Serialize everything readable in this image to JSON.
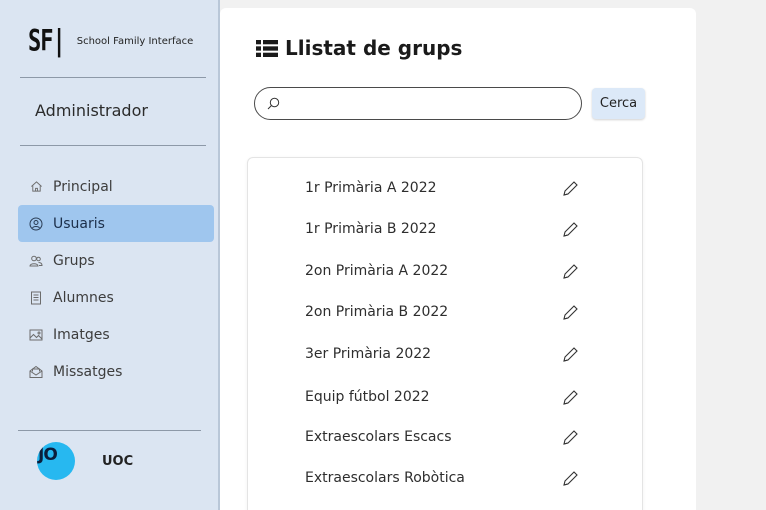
{
  "sidebar": {
    "logo_mark": "SF|",
    "brand": "School Family Interface",
    "role": "Administrador",
    "items": [
      {
        "label": "Principal",
        "icon": "home-icon"
      },
      {
        "label": "Usuaris",
        "icon": "user-circle-icon"
      },
      {
        "label": "Grups",
        "icon": "users-icon"
      },
      {
        "label": "Alumnes",
        "icon": "document-icon"
      },
      {
        "label": "Imatges",
        "icon": "image-icon"
      },
      {
        "label": "Missatges",
        "icon": "envelope-icon"
      }
    ],
    "active_item": "Usuaris",
    "footer_logo": "JO",
    "footer_label": "UOC"
  },
  "main": {
    "title": "Llistat de grups",
    "title_icon": "list-icon",
    "search": {
      "value": "",
      "placeholder": "",
      "icon": "search-icon"
    },
    "search_button": "Cerca",
    "groups": [
      "1r Primària A 2022",
      "1r Primària B 2022",
      "2on Primària A 2022",
      "2on Primària B 2022",
      "3er Primària 2022",
      "Equip fútbol 2022",
      "Extraescolars Escacs",
      "Extraescolars Robòtica"
    ],
    "row_action_icon": "pencil-icon"
  },
  "colors": {
    "sidebar_bg": "#dbe5f2",
    "active_item_bg": "#9fc6ee",
    "search_button_bg": "#dce9f8",
    "uoc_logo_bg": "#27b8f0",
    "page_bg": "#f1f1f1"
  }
}
